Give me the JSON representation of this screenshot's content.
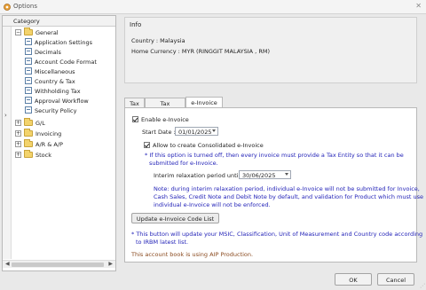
{
  "window": {
    "title": "Options",
    "close_glyph": "✕"
  },
  "sidebar": {
    "header": "Category",
    "items": [
      {
        "label": "General",
        "type": "folder",
        "expanded": true,
        "toggle": "−"
      },
      {
        "label": "Application Settings",
        "type": "leaf"
      },
      {
        "label": "Decimals",
        "type": "leaf"
      },
      {
        "label": "Account Code Format",
        "type": "leaf"
      },
      {
        "label": "Miscellaneous",
        "type": "leaf"
      },
      {
        "label": "Country & Tax",
        "type": "leaf",
        "selected": true
      },
      {
        "label": "Withholding Tax",
        "type": "leaf"
      },
      {
        "label": "Approval Workflow",
        "type": "leaf"
      },
      {
        "label": "Security Policy",
        "type": "leaf"
      },
      {
        "label": "G/L",
        "type": "folder",
        "expanded": false,
        "toggle": "+"
      },
      {
        "label": "Invoicing",
        "type": "folder",
        "expanded": false,
        "toggle": "+"
      },
      {
        "label": "A/R & A/P",
        "type": "folder",
        "expanded": false,
        "toggle": "+"
      },
      {
        "label": "Stock",
        "type": "folder",
        "expanded": false,
        "toggle": "+"
      }
    ],
    "row_indicator": "›"
  },
  "info": {
    "title": "Info",
    "country": "Country : Malaysia",
    "currency": "Home Currency : MYR (RINGGIT MALAYSIA , RM)"
  },
  "tabs": [
    {
      "label": "Tax",
      "active": false
    },
    {
      "label": "Tax Reporting",
      "active": false
    },
    {
      "label": "e-Invoice",
      "active": true
    }
  ],
  "einvoice": {
    "enable_label": "Enable e-Invoice",
    "enable_checked": true,
    "start_date_label": "Start Date :",
    "start_date_value": "01/01/2025",
    "consolidated_label": "Allow to create Consolidated e-Invoice",
    "consolidated_checked": true,
    "consolidated_note_1": "* If this option is turned off, then every invoice must provide a Tax Entity so that it can be",
    "consolidated_note_2": "submitted for e-Invoice.",
    "interim_label": "Interim relaxation period until :",
    "interim_value": "30/06/2025",
    "relax_note_1": "Note: during interim relaxation period, individual e-Invoice will not be submitted for Invoice,",
    "relax_note_2": "Cash Sales, Credit Note and Debit Note by default, and validation for Product which must use",
    "relax_note_3": "individual e-Invoice will not be enforced.",
    "update_button": "Update e-Invoice Code List",
    "update_note_1": "* This button will update your MSIC, Classification, Unit of Measurement and Country code according",
    "update_note_2": "to IRBM latest list.",
    "aip_note": "This account book is using AIP Production."
  },
  "footer": {
    "ok": "OK",
    "cancel": "Cancel"
  },
  "colors": {
    "note_blue": "#2323b8",
    "note_brown": "#8a4a1f",
    "folder": "#f3d36c"
  }
}
